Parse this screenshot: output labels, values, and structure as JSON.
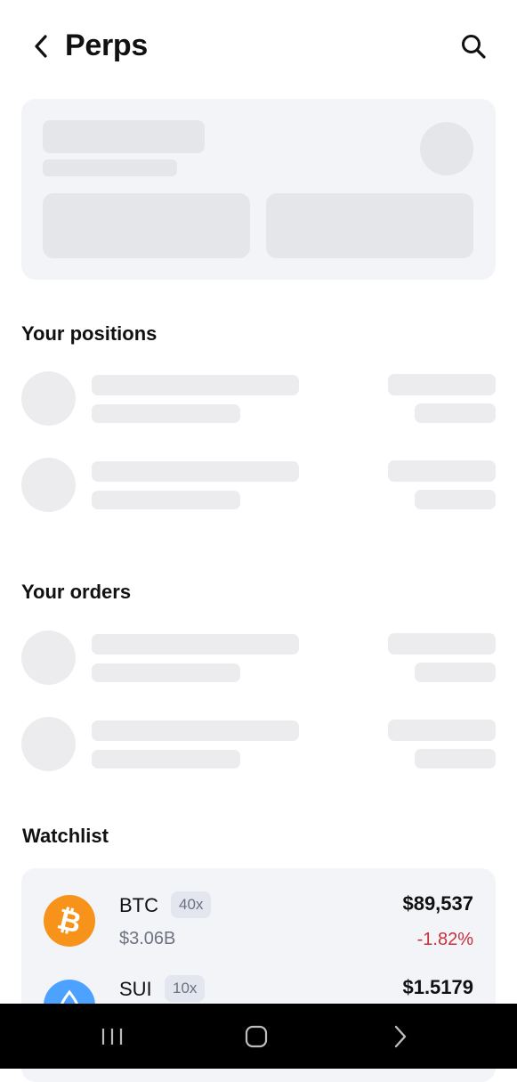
{
  "header": {
    "title": "Perps",
    "back_icon": "chevron-left-icon",
    "search_icon": "search-icon"
  },
  "sections": {
    "positions_title": "Your positions",
    "orders_title": "Your orders",
    "watchlist_title": "Watchlist"
  },
  "watchlist": {
    "items": [
      {
        "symbol": "BTC",
        "leverage": "40x",
        "volume": "$3.06B",
        "price": "$89,537",
        "change": "-1.82%",
        "icon": "bitcoin-icon",
        "icon_color": "#f7931a",
        "change_color": "#c8303c"
      },
      {
        "symbol": "SUI",
        "leverage": "10x",
        "price": "$1.5179",
        "icon": "sui-icon",
        "icon_color": "#4da2ff"
      }
    ]
  },
  "system_nav": {
    "recents_icon": "recents-icon",
    "home_icon": "home-icon",
    "back_icon": "nav-back-icon"
  },
  "colors": {
    "card_bg": "#f3f4f8",
    "skeleton": "#e4e6ea",
    "negative": "#c8303c",
    "nav_bar": "#000000"
  }
}
